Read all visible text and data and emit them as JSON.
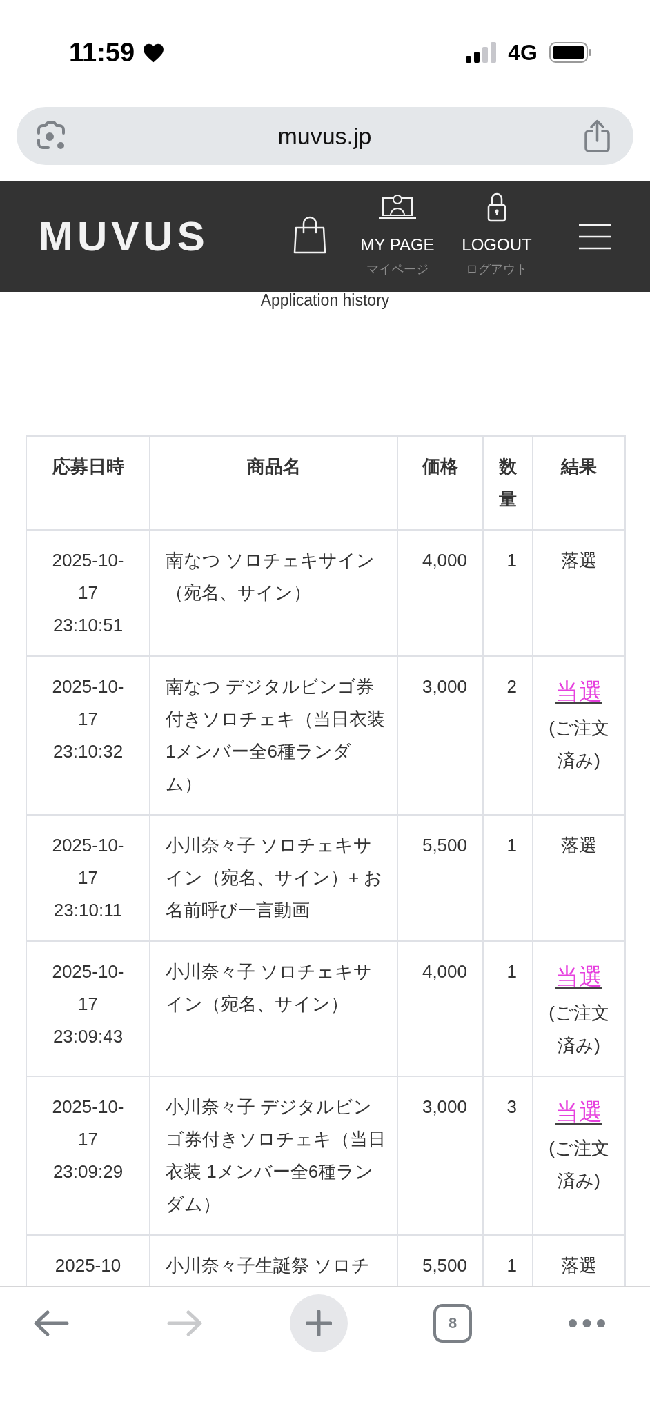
{
  "status_bar": {
    "time": "11:59",
    "network": "4G"
  },
  "address_bar": {
    "url": "muvus.jp"
  },
  "header": {
    "logo": "MUVUS",
    "nav": [
      {
        "label": "MY PAGE",
        "sublabel": "マイページ"
      },
      {
        "label": "LOGOUT",
        "sublabel": "ログアウト"
      }
    ]
  },
  "page_title": "Application history",
  "table": {
    "columns": [
      "応募日時",
      "商品名",
      "価格",
      "数量",
      "結果"
    ],
    "rows": [
      {
        "date": "2025-10-17 23:10:51",
        "product": "南なつ ソロチェキサイン（宛名、サイン）",
        "price": "4,000",
        "quantity": "1",
        "result": {
          "kind": "text",
          "label": "落選"
        }
      },
      {
        "date": "2025-10-17 23:10:32",
        "product": "南なつ デジタルビンゴ券付きソロチェキ（当日衣装 1メンバー全6種ランダム）",
        "price": "3,000",
        "quantity": "2",
        "result": {
          "kind": "link",
          "label": "当選",
          "note": "(ご注文済み)"
        }
      },
      {
        "date": "2025-10-17 23:10:11",
        "product": "小川奈々子 ソロチェキサイン（宛名、サイン）+ お名前呼び一言動画",
        "price": "5,500",
        "quantity": "1",
        "result": {
          "kind": "text",
          "label": "落選"
        }
      },
      {
        "date": "2025-10-17 23:09:43",
        "product": "小川奈々子 ソロチェキサイン（宛名、サイン）",
        "price": "4,000",
        "quantity": "1",
        "result": {
          "kind": "link",
          "label": "当選",
          "note": "(ご注文済み)"
        }
      },
      {
        "date": "2025-10-17 23:09:29",
        "product": "小川奈々子 デジタルビンゴ券付きソロチェキ（当日衣装 1メンバー全6種ランダム）",
        "price": "3,000",
        "quantity": "3",
        "result": {
          "kind": "link",
          "label": "当選",
          "note": "(ご注文済み)"
        }
      },
      {
        "date": "2025-10",
        "product": "小川奈々子生誕祭 ソロチ",
        "price": "5,500",
        "quantity": "1",
        "result": {
          "kind": "text",
          "label": "落選"
        }
      }
    ]
  },
  "toolbar": {
    "buttons": [
      {
        "kind": "back",
        "disabled": false
      },
      {
        "kind": "forward",
        "disabled": true
      },
      {
        "kind": "new-tab",
        "disabled": false
      },
      {
        "kind": "tabs",
        "label": "8",
        "disabled": false
      },
      {
        "kind": "more",
        "disabled": false
      }
    ]
  }
}
